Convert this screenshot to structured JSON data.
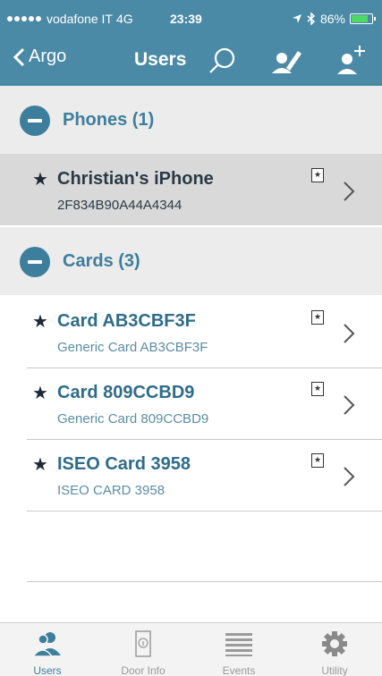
{
  "status": {
    "carrier": "vodafone IT",
    "network": "4G",
    "time": "23:39",
    "battery": "86%",
    "battery_level": 0.86
  },
  "nav": {
    "back_label": "Argo",
    "title": "Users"
  },
  "sections": [
    {
      "title": "Phones (1)",
      "items": [
        {
          "title": "Christian's iPhone",
          "subtitle": "2F834B90A44A4344"
        }
      ]
    },
    {
      "title": "Cards (3)",
      "items": [
        {
          "title": "Card AB3CBF3F",
          "subtitle": "Generic Card AB3CBF3F"
        },
        {
          "title": "Card 809CCBD9",
          "subtitle": "Generic Card 809CCBD9"
        },
        {
          "title": "ISEO Card 3958",
          "subtitle": "ISEO CARD 3958"
        }
      ]
    }
  ],
  "tabs": [
    {
      "label": "Users",
      "icon": "users-icon"
    },
    {
      "label": "Door Info",
      "icon": "door-info-icon"
    },
    {
      "label": "Events",
      "icon": "events-icon"
    },
    {
      "label": "Utility",
      "icon": "gear-icon"
    }
  ],
  "colors": {
    "accent": "#4a8aa6",
    "section_text": "#3d7e9c",
    "selected_row": "#d9d9d9"
  }
}
